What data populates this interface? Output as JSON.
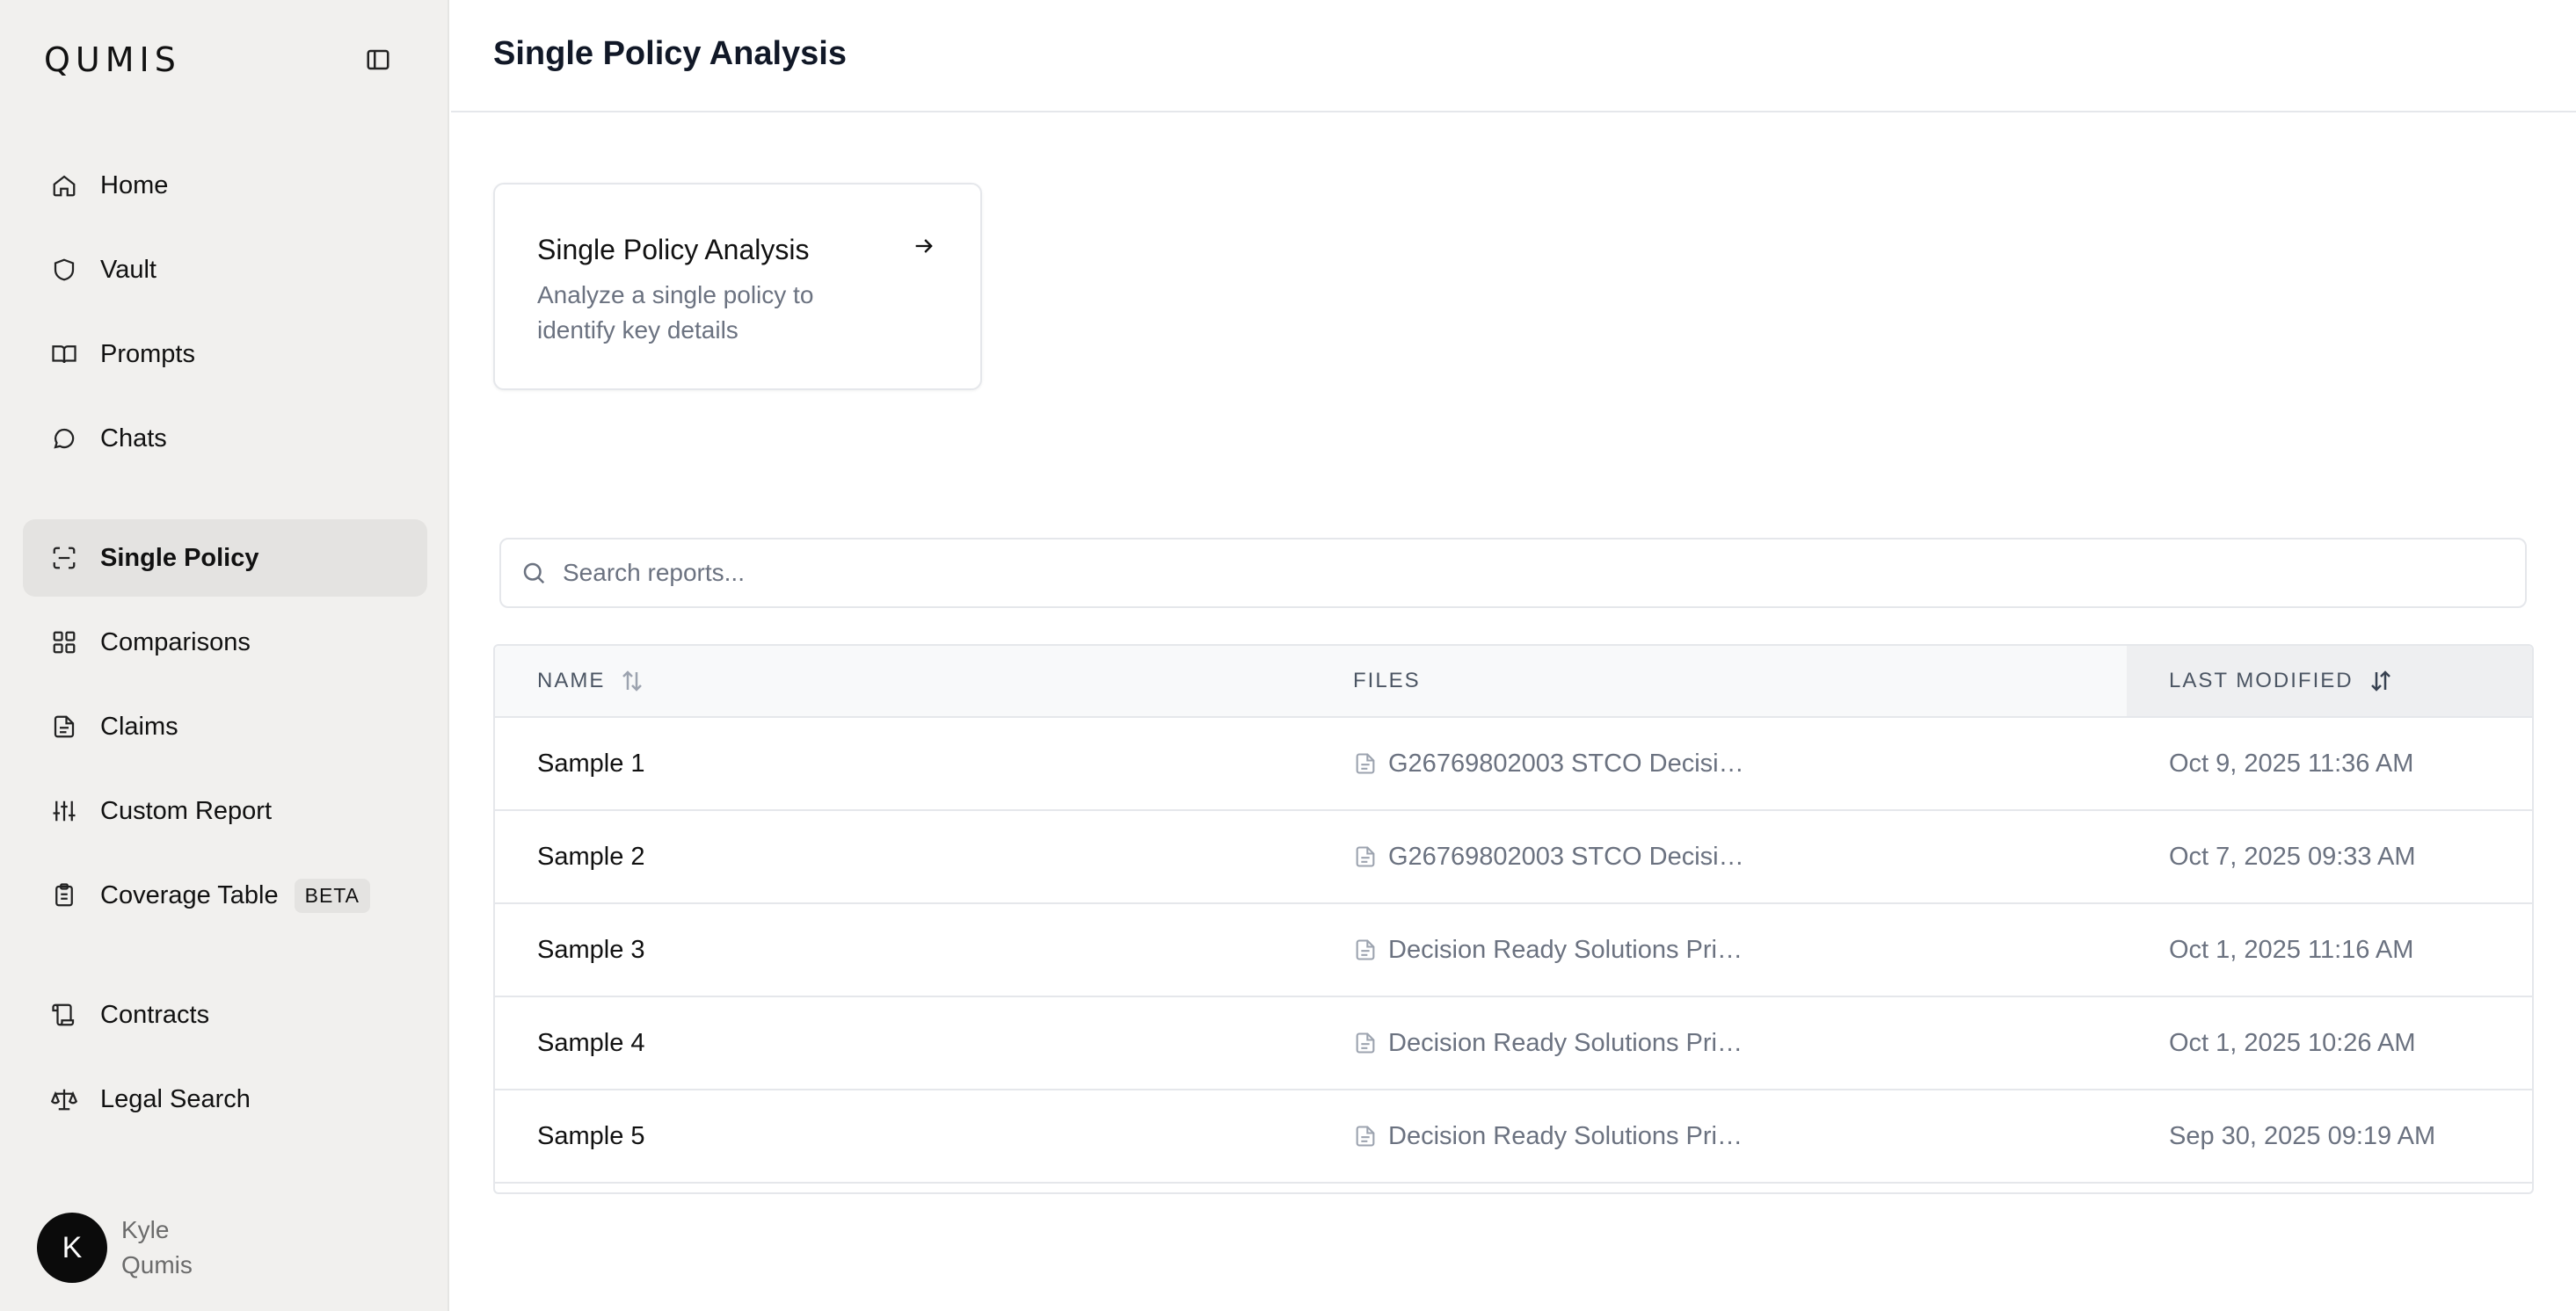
{
  "app": {
    "logo": "QUMIS"
  },
  "sidebar": {
    "items": [
      {
        "label": "Home",
        "icon": "home-icon"
      },
      {
        "label": "Vault",
        "icon": "shield-icon"
      },
      {
        "label": "Prompts",
        "icon": "book-open-icon"
      },
      {
        "label": "Chats",
        "icon": "chat-bubble-icon"
      },
      {
        "label": "Single Policy",
        "icon": "scan-icon",
        "active": true
      },
      {
        "label": "Comparisons",
        "icon": "grid-icon"
      },
      {
        "label": "Claims",
        "icon": "document-icon"
      },
      {
        "label": "Custom Report",
        "icon": "sliders-icon"
      },
      {
        "label": "Coverage Table",
        "icon": "clipboard-icon",
        "badge": "BETA"
      },
      {
        "label": "Contracts",
        "icon": "scroll-icon"
      },
      {
        "label": "Legal Search",
        "icon": "scale-icon"
      }
    ],
    "user": {
      "initial": "K",
      "first_name": "Kyle",
      "last_name": "Qumis"
    }
  },
  "header": {
    "title": "Single Policy Analysis"
  },
  "card": {
    "title": "Single Policy Analysis",
    "description": "Analyze a single policy to identify key details"
  },
  "search": {
    "placeholder": "Search reports..."
  },
  "table": {
    "columns": {
      "name": "NAME",
      "files": "FILES",
      "modified": "LAST MODIFIED"
    },
    "rows": [
      {
        "name": "Sample 1",
        "file": "G26769802003 STCO Decisi…",
        "modified": "Oct 9, 2025 11:36 AM"
      },
      {
        "name": "Sample 2",
        "file": "G26769802003 STCO Decisi…",
        "modified": "Oct 7, 2025 09:33 AM"
      },
      {
        "name": "Sample 3",
        "file": "Decision Ready Solutions Pri…",
        "modified": "Oct 1, 2025 11:16 AM"
      },
      {
        "name": "Sample 4",
        "file": "Decision Ready Solutions Pri…",
        "modified": "Oct 1, 2025 10:26 AM"
      },
      {
        "name": "Sample 5",
        "file": "Decision Ready Solutions Pri…",
        "modified": "Sep 30, 2025 09:19 AM"
      }
    ]
  }
}
